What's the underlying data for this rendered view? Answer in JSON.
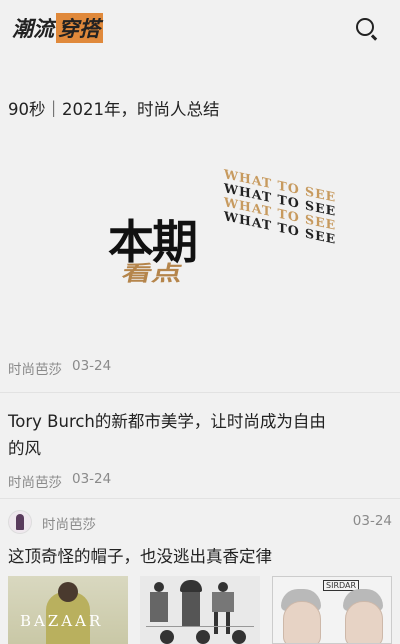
{
  "header": {
    "logo_part1": "潮流",
    "logo_part2": "穿搭",
    "search_icon": "search-icon"
  },
  "articles": [
    {
      "title": "90秒｜2021年，时尚人总结",
      "cover_text_main": "本期",
      "cover_text_sub": "看点",
      "cover_repeat_text": "WHAT TO SEE",
      "source": "时尚芭莎",
      "date": "03-24"
    },
    {
      "title": "Tory Burch的新都市美学，让时尚成为自由的风",
      "source": "时尚芭莎",
      "date": "03-24"
    },
    {
      "author": "时尚芭莎",
      "date": "03-24",
      "title": "这顶奇怪的帽子，也没逃出真香定律",
      "thumb1_text": "BAZAAR",
      "thumb3_text": "SIRDAR"
    }
  ],
  "colors": {
    "accent": "#e0893b",
    "gold": "#c79a5e",
    "meta": "#8a8a8a",
    "background": "#f1f1f1"
  }
}
